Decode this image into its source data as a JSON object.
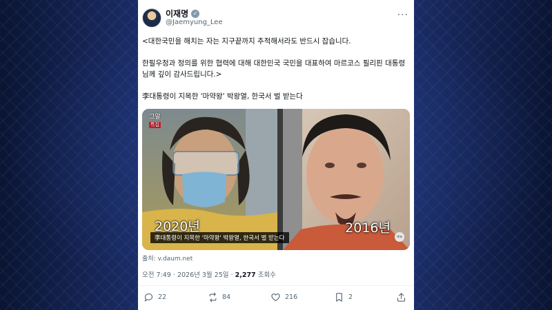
{
  "post": {
    "author_name": "이재명",
    "author_handle": "@Jaemyung_Lee",
    "more_glyph": "···",
    "verified_glyph": "✓",
    "paragraph1": "<대한국민을 해치는 자는 지구끝까지 추적해서라도 반드시 잡습니다.",
    "paragraph2": "한필우정과 정의를 위한 협력에 대해 대한민국 국민을 대표하여 마르코스 필리핀 대통령님께 깊이 감사드립니다.>",
    "paragraph3": "李대통령이 지목한 '마약왕' 박왕열, 한국서 벌 받는다",
    "media": {
      "caption": "李대통령이 지목한 '마약왕' 박왕열, 한국서 벌 받는다",
      "year_left": "2020년",
      "year_right": "2016년",
      "logo_right": "dia"
    },
    "source": "출처: v.daum.net",
    "time": "오전 7:49",
    "separator": "·",
    "date": "2026년 3월 25일",
    "views_count": "2,277",
    "views_label": "조회수"
  },
  "actions": {
    "replies": "22",
    "reposts": "84",
    "likes": "216",
    "bookmarks": "2"
  },
  "colors": {
    "accent": "#1d9bf0",
    "muted": "#536471",
    "background": "#0d1a3e"
  },
  "icons": [
    "reply-icon",
    "repost-icon",
    "like-icon",
    "bookmark-icon",
    "share-icon",
    "verified-icon",
    "more-icon"
  ]
}
